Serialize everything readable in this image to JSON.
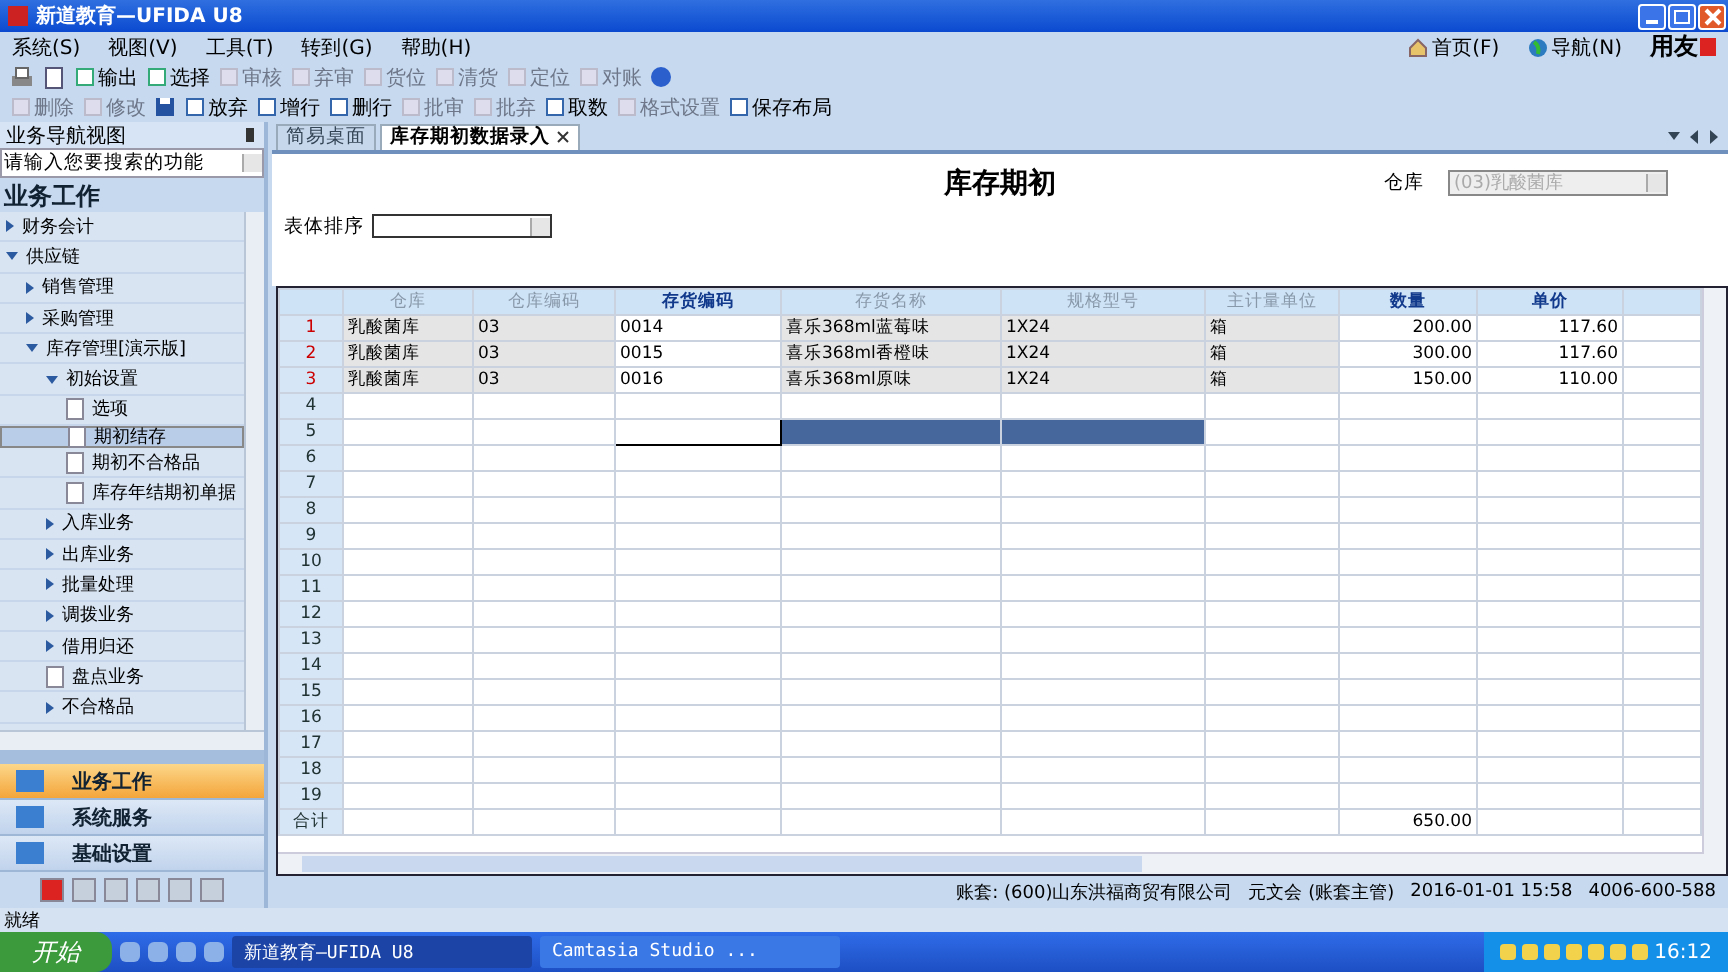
{
  "window": {
    "title": "新道教育—UFIDA U8"
  },
  "menu": [
    "系统(S)",
    "视图(V)",
    "工具(T)",
    "转到(G)",
    "帮助(H)"
  ],
  "toolbar_1": [
    {
      "label": "输出",
      "disabled": false
    },
    {
      "label": "选择",
      "disabled": false
    },
    {
      "label": "审核",
      "disabled": true
    },
    {
      "label": "弃审",
      "disabled": true
    },
    {
      "label": "货位",
      "disabled": true
    },
    {
      "label": "清货",
      "disabled": true
    },
    {
      "label": "定位",
      "disabled": true
    },
    {
      "label": "对账",
      "disabled": true
    }
  ],
  "toolbar_2": [
    {
      "label": "删除",
      "disabled": true
    },
    {
      "label": "修改",
      "disabled": true
    },
    {
      "label": "放弃",
      "disabled": false
    },
    {
      "label": "增行",
      "disabled": false
    },
    {
      "label": "删行",
      "disabled": false
    },
    {
      "label": "批审",
      "disabled": true
    },
    {
      "label": "批弃",
      "disabled": true
    },
    {
      "label": "取数",
      "disabled": false
    },
    {
      "label": "格式设置",
      "disabled": true
    },
    {
      "label": "保存布局",
      "disabled": false
    }
  ],
  "top_links": [
    "首页(F)",
    "导航(N)"
  ],
  "brand": "用友",
  "nav": {
    "header": "业务导航视图",
    "search": {
      "placeholder": "请输入您要搜索的功能"
    },
    "section": "业务工作",
    "tree": [
      {
        "label": "财务会计",
        "kind": "folder",
        "expanded": false,
        "selected": false
      },
      {
        "label": "供应链",
        "kind": "folder",
        "expanded": true,
        "selected": false,
        "children": [
          {
            "label": "销售管理",
            "kind": "folder",
            "expanded": false,
            "selected": false
          },
          {
            "label": "采购管理",
            "kind": "folder",
            "expanded": false,
            "selected": false
          },
          {
            "label": "库存管理[演示版]",
            "kind": "folder",
            "expanded": true,
            "selected": false,
            "children": [
              {
                "label": "初始设置",
                "kind": "folder",
                "expanded": true,
                "selected": false,
                "children": [
                  {
                    "label": "选项",
                    "kind": "page",
                    "selected": false
                  },
                  {
                    "label": "期初结存",
                    "kind": "page",
                    "selected": true
                  },
                  {
                    "label": "期初不合格品",
                    "kind": "page",
                    "selected": false
                  },
                  {
                    "label": "库存年结期初单据",
                    "kind": "page",
                    "selected": false
                  }
                ]
              },
              {
                "label": "入库业务",
                "kind": "folder",
                "expanded": false,
                "selected": false
              },
              {
                "label": "出库业务",
                "kind": "folder",
                "expanded": false,
                "selected": false
              },
              {
                "label": "批量处理",
                "kind": "folder",
                "expanded": false,
                "selected": false
              },
              {
                "label": "调拨业务",
                "kind": "folder",
                "expanded": false,
                "selected": false
              },
              {
                "label": "借用归还",
                "kind": "folder",
                "expanded": false,
                "selected": false
              },
              {
                "label": "盘点业务",
                "kind": "page",
                "selected": false
              },
              {
                "label": "不合格品",
                "kind": "folder",
                "expanded": false,
                "selected": false
              }
            ]
          }
        ]
      }
    ],
    "modules": [
      {
        "label": "业务工作",
        "selected": true
      },
      {
        "label": "系统服务",
        "selected": false
      },
      {
        "label": "基础设置",
        "selected": false
      }
    ]
  },
  "tabs": [
    {
      "label": "简易桌面",
      "selected": false,
      "closable": false
    },
    {
      "label": "库存期初数据录入",
      "selected": true,
      "closable": true
    }
  ],
  "form": {
    "title": "库存期初",
    "warehouse_label": "仓库",
    "warehouse_value": "(03)乳酸菌库",
    "warehouse_disabled": true,
    "sort_label": "表体排序"
  },
  "table": {
    "columns": [
      {
        "label": "仓库",
        "kind": "readonly"
      },
      {
        "label": "仓库编码",
        "kind": "readonly"
      },
      {
        "label": "存货编码",
        "kind": "editable"
      },
      {
        "label": "存货名称",
        "kind": "readonly"
      },
      {
        "label": "规格型号",
        "kind": "readonly"
      },
      {
        "label": "主计量单位",
        "kind": "readonly"
      },
      {
        "label": "数量",
        "kind": "editable"
      },
      {
        "label": "单价",
        "kind": "editable"
      }
    ],
    "rows": [
      {
        "num": "1",
        "selected": false,
        "cells": [
          "乳酸菌库",
          "03",
          "0014",
          "喜乐368ml蓝莓味",
          "1X24",
          "箱",
          "200.00",
          "117.60"
        ]
      },
      {
        "num": "2",
        "selected": false,
        "cells": [
          "乳酸菌库",
          "03",
          "0015",
          "喜乐368ml香橙味",
          "1X24",
          "箱",
          "300.00",
          "117.60"
        ]
      },
      {
        "num": "3",
        "selected": false,
        "cells": [
          "乳酸菌库",
          "03",
          "0016",
          "喜乐368ml原味",
          "1X24",
          "箱",
          "150.00",
          "110.00"
        ]
      },
      {
        "num": "4",
        "selected": false
      },
      {
        "num": "5",
        "selected": true
      },
      {
        "num": "6",
        "selected": false
      },
      {
        "num": "7",
        "selected": false
      },
      {
        "num": "8",
        "selected": false
      },
      {
        "num": "9",
        "selected": false
      },
      {
        "num": "10",
        "selected": false
      },
      {
        "num": "11",
        "selected": false
      },
      {
        "num": "12",
        "selected": false
      },
      {
        "num": "13",
        "selected": false
      },
      {
        "num": "14",
        "selected": false
      },
      {
        "num": "15",
        "selected": false
      },
      {
        "num": "16",
        "selected": false
      },
      {
        "num": "17",
        "selected": false
      },
      {
        "num": "18",
        "selected": false
      },
      {
        "num": "19",
        "selected": false
      }
    ],
    "total": {
      "label": "合计",
      "quantity": "650.00"
    }
  },
  "status_bar": {
    "account": "账套: (600)山东洪福商贸有限公司",
    "user": "元文会 (账套主管)",
    "datetime": "2016-01-01 15:58",
    "phone": "4006-600-588",
    "ready": "就绪"
  },
  "taskbar": {
    "start": "开始",
    "tasks": [
      {
        "label": "新道教育—UFIDA U8",
        "selected": true
      },
      {
        "label": "Camtasia Studio ...",
        "selected": false
      }
    ],
    "clock": "16:12"
  }
}
